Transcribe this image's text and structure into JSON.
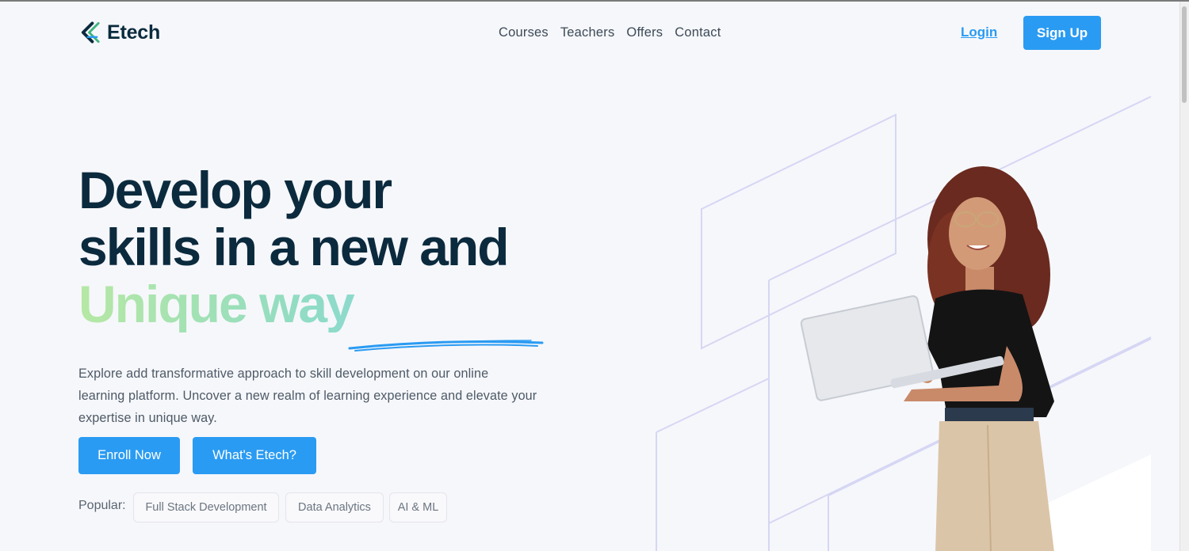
{
  "brand": {
    "name": "Etech"
  },
  "nav": {
    "items": [
      "Courses",
      "Teachers",
      "Offers",
      "Contact"
    ]
  },
  "auth": {
    "login_label": "Login",
    "signup_label": "Sign Up"
  },
  "hero": {
    "headline_line1": "Develop your",
    "headline_line2": "skills in a new and",
    "headline_highlight": "Unique way",
    "description": "Explore add transformative approach to skill development on our online learning platform. Uncover a new realm of learning experience and elevate your expertise in unique way.",
    "enroll_label": "Enroll Now",
    "what_label": "What's Etech?",
    "popular_label": "Popular:",
    "popular_tags": [
      "Full Stack Development",
      "Data Analytics",
      "AI & ML"
    ]
  },
  "colors": {
    "primary": "#2a9bf2",
    "heading": "#0b2a3d",
    "highlight_start": "#b6e8a4",
    "highlight_end": "#7fd6ea",
    "decor_lines": "#d6d6f4"
  },
  "icons": {
    "logo": "etech-chevron-logo-icon"
  }
}
